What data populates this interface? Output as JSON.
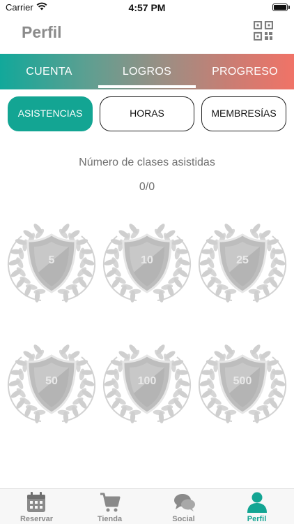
{
  "status_bar": {
    "carrier": "Carrier",
    "time": "4:57 PM"
  },
  "header": {
    "title": "Perfil",
    "qr_icon": "qr-code-icon"
  },
  "tabs": [
    {
      "label": "CUENTA",
      "selected": false
    },
    {
      "label": "LOGROS",
      "selected": true
    },
    {
      "label": "PROGRESO",
      "selected": false
    }
  ],
  "segments": [
    {
      "label": "ASISTENCIAS",
      "selected": true
    },
    {
      "label": "HORAS",
      "selected": false
    },
    {
      "label": "MEMBRESÍAS",
      "selected": false
    }
  ],
  "achievements": {
    "title": "Número de clases asistidas",
    "progress": "0/0",
    "badges": [
      "5",
      "10",
      "25",
      "50",
      "100",
      "500"
    ]
  },
  "bottom_nav": [
    {
      "label": "Reservar",
      "icon": "calendar-icon",
      "active": false
    },
    {
      "label": "Tienda",
      "icon": "cart-icon",
      "active": false
    },
    {
      "label": "Social",
      "icon": "chat-bubbles-icon",
      "active": false
    },
    {
      "label": "Perfil",
      "icon": "person-icon",
      "active": true
    }
  ],
  "colors": {
    "accent": "#13a593",
    "gradient_start": "#12a89a",
    "gradient_end": "#f07367",
    "badge_gray": "#c9c9c9"
  }
}
